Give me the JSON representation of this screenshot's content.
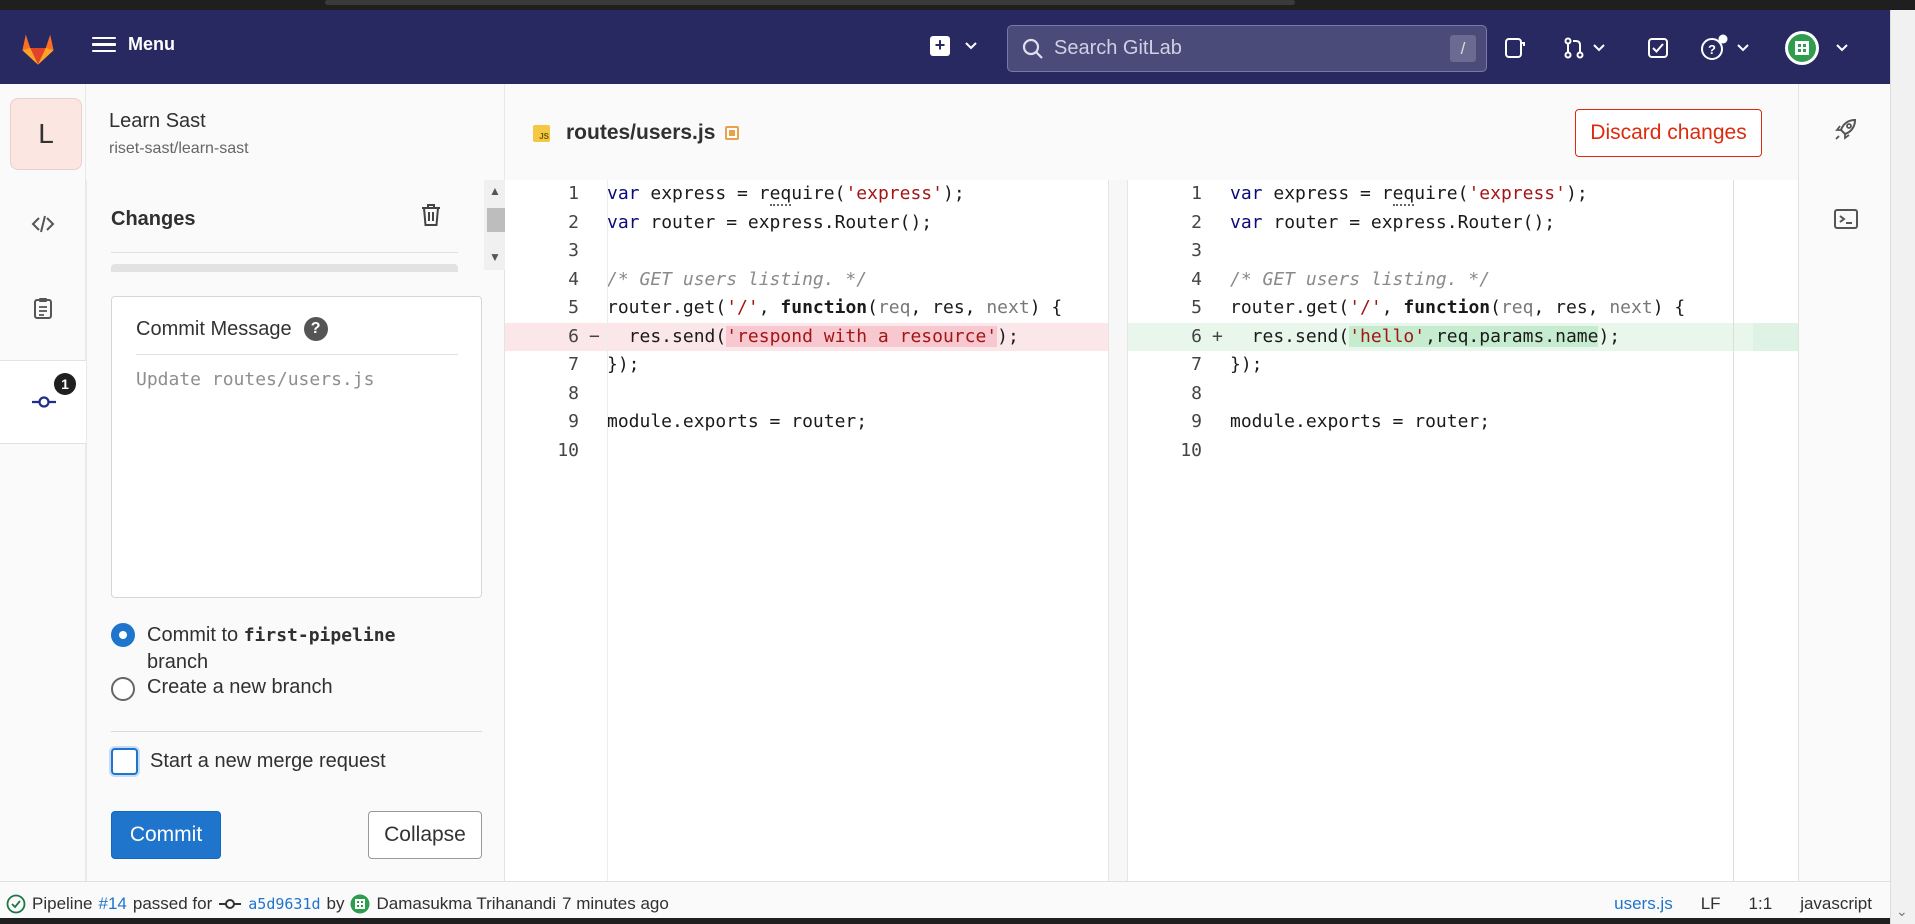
{
  "nav": {
    "menu_label": "Menu",
    "search_placeholder": "Search GitLab",
    "search_shortcut": "/"
  },
  "project": {
    "avatar_letter": "L",
    "name": "Learn Sast",
    "path": "riset-sast/learn-sast"
  },
  "sidebar": {
    "commit_badge_count": "1"
  },
  "changes_panel": {
    "title": "Changes",
    "commit_message_label": "Commit Message",
    "commit_message_help": "?",
    "commit_message_placeholder": "Update routes/users.js",
    "commit_to_prefix": "Commit to ",
    "commit_to_branch": "first-pipeline",
    "commit_to_suffix": "branch",
    "new_branch_label": "Create a new branch",
    "merge_request_label": "Start a new merge request",
    "commit_button": "Commit",
    "collapse_button": "Collapse"
  },
  "file": {
    "name": "routes/users.js",
    "type_icon": "js-file-icon",
    "discard_button": "Discard changes"
  },
  "diff": {
    "left": [
      "1",
      "2",
      "3",
      "4",
      "5",
      "6",
      "7",
      "8",
      "9",
      "10"
    ],
    "right": [
      "1",
      "2",
      "3",
      "4",
      "5",
      "6",
      "7",
      "8",
      "9",
      "10"
    ]
  },
  "status": {
    "pipeline_label": "Pipeline",
    "pipeline_id": "#14",
    "passed_for": "passed for",
    "commit_sha": "a5d9631d",
    "by": "by",
    "author": "Damasukma Trihanandi",
    "time": "7 minutes ago",
    "filename": "users.js",
    "line_ending": "LF",
    "cursor": "1:1",
    "language": "javascript"
  },
  "colors": {
    "nav_bg": "#292961",
    "primary": "#1f75cb",
    "danger": "#dd2b0e",
    "deleted_bg": "#fbe6e9",
    "added_bg": "#e8f6ec"
  }
}
